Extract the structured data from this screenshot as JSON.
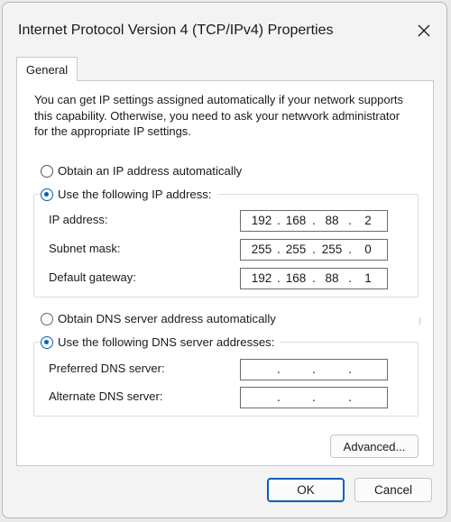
{
  "window": {
    "title": "Internet Protocol Version 4 (TCP/IPv4) Properties"
  },
  "tabs": [
    {
      "label": "General",
      "selected": true
    }
  ],
  "description": "You can get IP settings assigned automatically if your network supports this capability. Otherwise, you need to ask your netwvork administrator for the appropriate IP settings.",
  "ip_section": {
    "auto_option": {
      "label": "Obtain an IP address automatically",
      "checked": false
    },
    "manual_option": {
      "label": "Use the following IP address:",
      "checked": true
    },
    "fields": [
      {
        "label": "IP address:",
        "octets": [
          "192",
          "168",
          "88",
          "2"
        ]
      },
      {
        "label": "Subnet mask:",
        "octets": [
          "255",
          "255",
          "255",
          "0"
        ]
      },
      {
        "label": "Default gateway:",
        "octets": [
          "192",
          "168",
          "88",
          "1"
        ]
      }
    ]
  },
  "dns_section": {
    "auto_option": {
      "label": "Obtain DNS server address automatically",
      "checked": false
    },
    "manual_option": {
      "label": "Use the following DNS server addresses:",
      "checked": true
    },
    "fields": [
      {
        "label": "Preferred DNS server:",
        "octets": [
          "",
          "",
          "",
          ""
        ]
      },
      {
        "label": "Alternate DNS server:",
        "octets": [
          "",
          "",
          "",
          ""
        ]
      }
    ]
  },
  "buttons": {
    "advanced": "Advanced...",
    "ok": "OK",
    "cancel": "Cancel"
  },
  "colors": {
    "accent": "#0a5fb4",
    "window_bg": "#f3f3f3",
    "panel_bg": "#ffffff"
  },
  "icons": {
    "close": "close-icon"
  }
}
